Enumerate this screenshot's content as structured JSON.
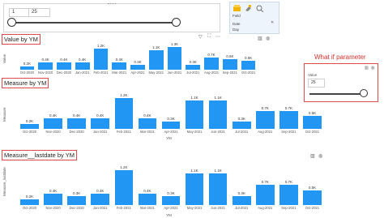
{
  "slicer": {
    "min_value": "1",
    "max_value": "25"
  },
  "fields_pane": {
    "header": "Field",
    "date_label": "Date",
    "day_label": "Day"
  },
  "charts": [
    {
      "title": "Value by YM",
      "ylabel": "Value",
      "xlabel": ""
    },
    {
      "title": "Measure by YM",
      "ylabel": "Measure",
      "xlabel": "YM"
    },
    {
      "title": "Measure__lastdate by YM",
      "ylabel": "Measure_lastdate",
      "xlabel": "YM"
    }
  ],
  "what_if": {
    "title": "What if parameter",
    "label": "Value",
    "value": "25",
    "slider_fraction": 1.0
  },
  "chart_data": [
    {
      "type": "bar",
      "title": "Value by YM",
      "categories": [
        "Oct-2020",
        "Nov-2020",
        "Dec-2020",
        "Jan-2021",
        "Feb-2021",
        "Mar-2021",
        "Apr-2021",
        "May-2021",
        "Jun-2021",
        "Jul-2021",
        "Aug-2021",
        "Sep-2021",
        "Oct-2021"
      ],
      "values": [
        0.2,
        0.4,
        0.4,
        0.4,
        1.2,
        0.4,
        0.3,
        1.1,
        1.3,
        0.3,
        0.7,
        0.6,
        0.5
      ],
      "labels": [
        "0.2K",
        "0.4K",
        "0.4K",
        "0.4K",
        "1.2K",
        "0.4K",
        "0.3K",
        "1.1K",
        "1.3K",
        "0.3K",
        "0.7K",
        "0.6K",
        "0.5K"
      ],
      "ylim": [
        0,
        1.4
      ]
    },
    {
      "type": "bar",
      "title": "Measure by YM",
      "categories": [
        "Oct-2020",
        "Nov-2020",
        "Dec-2020",
        "Jan-2021",
        "Feb-2021",
        "Mar-2021",
        "Apr-2021",
        "May-2021",
        "Jun-2021",
        "Jul-2021",
        "Aug-2021",
        "Sep-2021",
        "Oct-2021"
      ],
      "values": [
        0.2,
        0.4,
        0.4,
        0.4,
        1.2,
        0.4,
        0.3,
        1.1,
        1.1,
        0.3,
        0.7,
        0.7,
        0.5
      ],
      "labels": [
        "0.2K",
        "0.4K",
        "0.4K",
        "0.4K",
        "1.2K",
        "0.4K",
        "0.3K",
        "1.1K",
        "1.1K",
        "0.3K",
        "0.7K",
        "0.7K",
        "0.5K"
      ],
      "ylim": [
        0,
        1.4
      ]
    },
    {
      "type": "bar",
      "title": "Measure__lastdate by YM",
      "categories": [
        "Oct-2020",
        "Nov-2020",
        "Dec-2020",
        "Jan-2021",
        "Feb-2021",
        "Mar-2021",
        "Apr-2021",
        "May-2021",
        "Jun-2021",
        "Jul-2021",
        "Aug-2021",
        "Sep-2021",
        "Oct-2021"
      ],
      "values": [
        0.2,
        0.4,
        0.3,
        0.4,
        1.2,
        0.4,
        0.3,
        1.1,
        1.1,
        0.3,
        0.7,
        0.7,
        0.5
      ],
      "labels": [
        "0.2K",
        "0.4K",
        "0.3K",
        "0.4K",
        "1.2K",
        "0.4K",
        "0.3K",
        "1.1K",
        "1.1K",
        "0.3K",
        "0.7K",
        "0.7K",
        "0.5K"
      ],
      "ylim": [
        0,
        1.4
      ]
    }
  ],
  "colors": {
    "bar": "#2196f3",
    "highlight_border": "#e04a4a",
    "annotation_text": "#d8302f"
  }
}
